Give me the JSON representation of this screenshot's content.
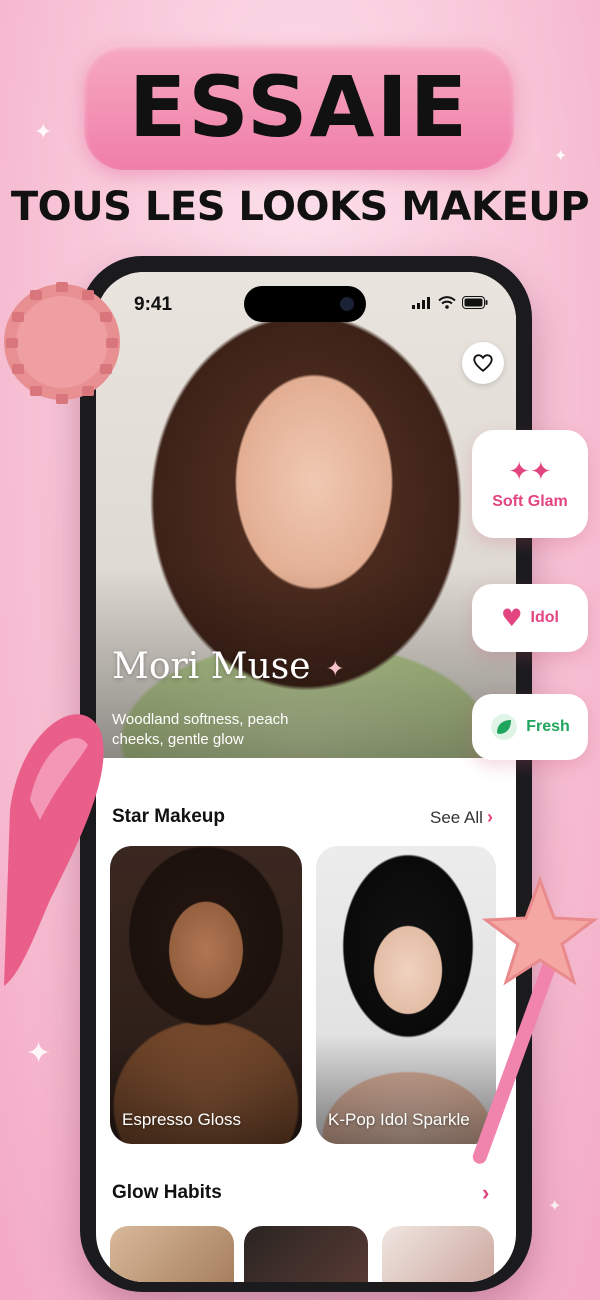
{
  "promo": {
    "headline": "ESSAIE",
    "subheadline": "TOUS LES LOOKS MAKEUP"
  },
  "status_bar": {
    "time": "9:41"
  },
  "hero": {
    "title": "Mori Muse",
    "description": "Woodland softness, peach cheeks, gentle glow",
    "favorite_icon": "heart-icon"
  },
  "chips": [
    {
      "label": "Soft Glam",
      "icon": "sparkles-icon",
      "color": "#e2457f"
    },
    {
      "label": "Idol",
      "icon": "heart-sparkle-icon",
      "color": "#e2457f"
    },
    {
      "label": "Fresh",
      "icon": "leaf-icon",
      "color": "#1fa55d"
    }
  ],
  "star_makeup": {
    "title": "Star Makeup",
    "see_all": "See All",
    "cards": [
      {
        "label": "Espresso Gloss"
      },
      {
        "label": "K-Pop Idol Sparkle"
      }
    ]
  },
  "glow_habits": {
    "title": "Glow Habits"
  },
  "colors": {
    "accent_pink": "#e2457f",
    "pill_pink": "#f07ea7",
    "fresh_green": "#1fa55d"
  }
}
